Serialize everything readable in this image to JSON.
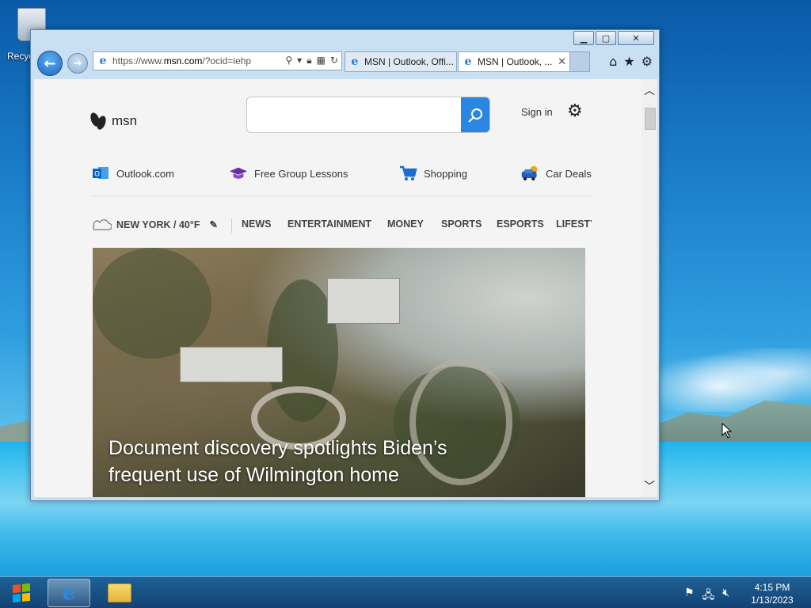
{
  "desktop": {
    "recycle_bin_label": "Recyc"
  },
  "browser": {
    "address": {
      "url_prefix": "https://www.",
      "url_domain": "msn.com",
      "url_suffix": "/?ocid=iehp"
    },
    "tabs": [
      {
        "label": "MSN | Outlook, Offi...",
        "active": false
      },
      {
        "label": "MSN | Outlook, ...",
        "active": true,
        "close": "✕"
      }
    ],
    "window_controls": {
      "minimize": "▁",
      "maximize": "▢",
      "close": "✕"
    }
  },
  "page": {
    "logo_text": "msn",
    "search_placeholder": "",
    "sign_in": "Sign in",
    "quick_links": [
      {
        "label": "Outlook.com",
        "icon": "outlook-icon"
      },
      {
        "label": "Free Group Lessons",
        "icon": "graduation-cap-icon"
      },
      {
        "label": "Shopping",
        "icon": "cart-icon"
      },
      {
        "label": "Car Deals",
        "icon": "car-icon"
      }
    ],
    "weather": "NEW YORK / 40°F",
    "categories": [
      "NEWS",
      "ENTERTAINMENT",
      "MONEY",
      "SPORTS",
      "ESPORTS",
      "LIFESTY"
    ],
    "hero": {
      "title_line1": "Document discovery spotlights Biden’s",
      "title_line2": "frequent use of Wilmington home"
    }
  },
  "taskbar": {
    "time": "4:15 PM",
    "date": "1/13/2023"
  },
  "colors": {
    "accent": "#2a86e0",
    "taskbar": "#1e5a8c"
  }
}
